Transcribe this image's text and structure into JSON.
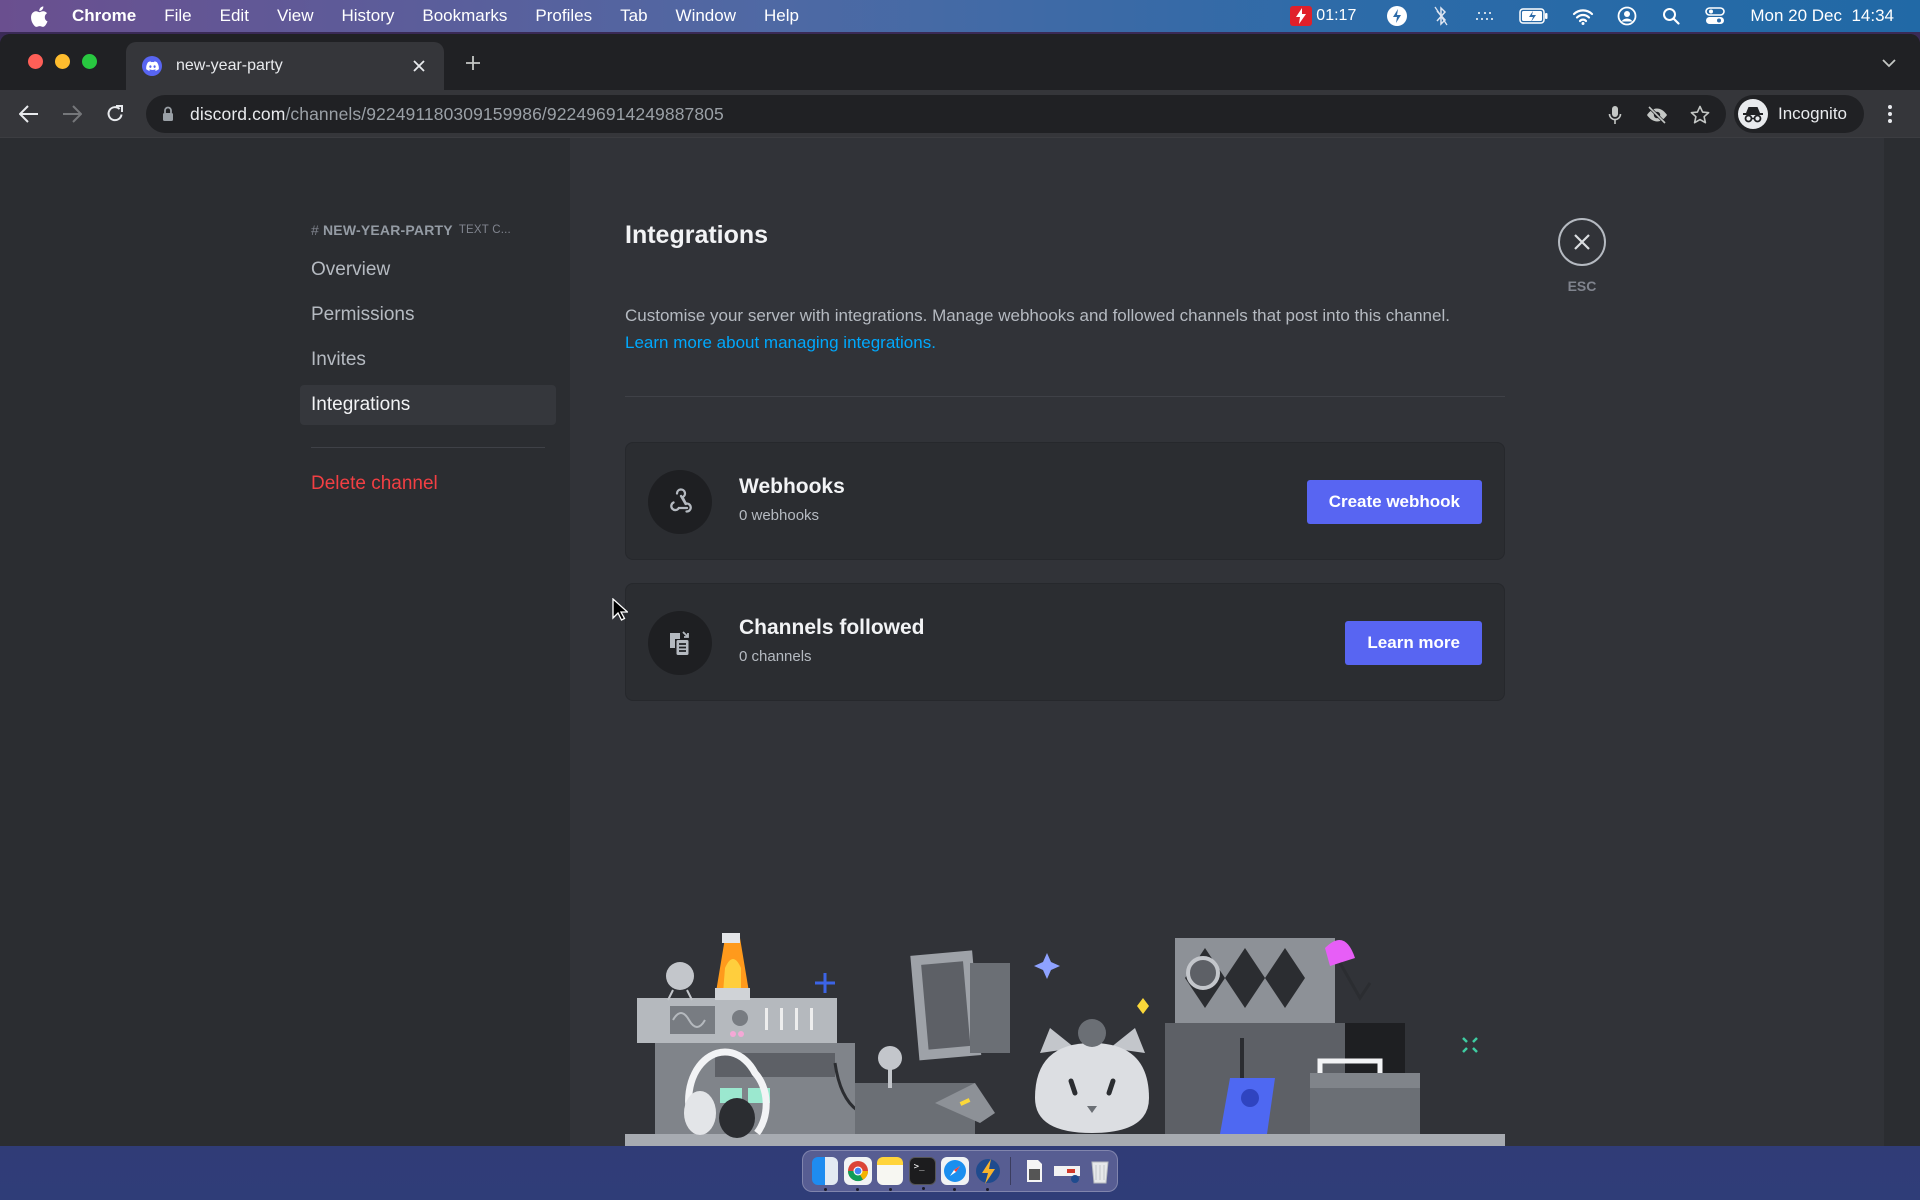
{
  "menubar": {
    "app_name": "Chrome",
    "items": [
      "File",
      "Edit",
      "View",
      "History",
      "Bookmarks",
      "Profiles",
      "Tab",
      "Window",
      "Help"
    ],
    "recording_time": "01:17",
    "datetime": "Mon 20 Dec  14:34",
    "status_icons": [
      "screen-recording-icon",
      "bolt-app-icon",
      "bluetooth-off-icon",
      "dots-icon",
      "battery-charging-icon",
      "wifi-icon",
      "user-account-icon",
      "spotlight-search-icon",
      "control-center-icon"
    ]
  },
  "browser": {
    "tab_title": "new-year-party",
    "url_host": "discord.com",
    "url_path": "/channels/922491180309159986/922496914249887805",
    "profile_label": "Incognito"
  },
  "sidebar": {
    "channel_name": "NEW-YEAR-PARTY",
    "channel_type": "TEXT C...",
    "items": [
      {
        "label": "Overview",
        "selected": false
      },
      {
        "label": "Permissions",
        "selected": false
      },
      {
        "label": "Invites",
        "selected": false
      },
      {
        "label": "Integrations",
        "selected": true
      }
    ],
    "delete_label": "Delete channel"
  },
  "main": {
    "title": "Integrations",
    "description": "Customise your server with integrations. Manage webhooks and followed channels that post into this channel.",
    "learn_link": "Learn more about managing integrations.",
    "cards": [
      {
        "title": "Webhooks",
        "subtitle": "0 webhooks",
        "button": "Create webhook",
        "icon": "webhook-icon"
      },
      {
        "title": "Channels followed",
        "subtitle": "0 channels",
        "button": "Learn more",
        "icon": "channel-follow-icon"
      }
    ],
    "close_hint": "ESC"
  },
  "dock": {
    "apps": [
      "finder",
      "chrome",
      "notes",
      "terminal",
      "safari",
      "reeder",
      "archive",
      "preview-window",
      "trash"
    ]
  },
  "colors": {
    "accent": "#5865f2",
    "danger": "#f23f43",
    "link": "#00a8fc",
    "background": "#313338",
    "sidebar": "#2b2d31"
  }
}
